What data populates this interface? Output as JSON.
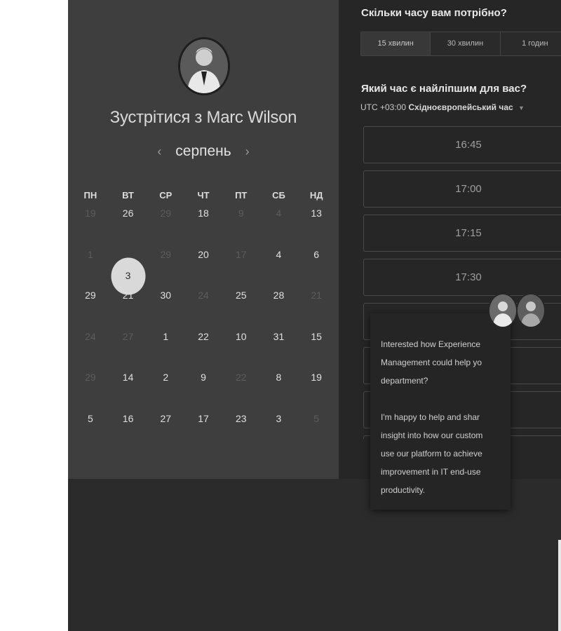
{
  "host": {
    "meet_title": "Зустрітися з Marc Wilson",
    "avatar_icon": "person-avatar-icon"
  },
  "calendar": {
    "month": "серпень",
    "prev_icon": "chevron-left-icon",
    "next_icon": "chevron-right-icon",
    "weekdays": [
      "ПН",
      "ВТ",
      "СР",
      "ЧТ",
      "ПТ",
      "СБ",
      "НД"
    ],
    "weeks": [
      [
        {
          "d": "19",
          "m": true
        },
        {
          "d": "26",
          "m": false
        },
        {
          "d": "29",
          "m": true
        },
        {
          "d": "18",
          "m": false
        },
        {
          "d": "9",
          "m": true
        },
        {
          "d": "4",
          "m": true
        },
        {
          "d": "13",
          "m": false
        }
      ],
      [
        {
          "d": "1",
          "m": true
        },
        {
          "d": "3",
          "m": false,
          "sel": true
        },
        {
          "d": "29",
          "m": true
        },
        {
          "d": "20",
          "m": false
        },
        {
          "d": "17",
          "m": true
        },
        {
          "d": "4",
          "m": false
        },
        {
          "d": "6",
          "m": false
        }
      ],
      [
        {
          "d": "29",
          "m": false
        },
        {
          "d": "21",
          "m": false
        },
        {
          "d": "30",
          "m": false
        },
        {
          "d": "24",
          "m": true
        },
        {
          "d": "25",
          "m": false
        },
        {
          "d": "28",
          "m": false
        },
        {
          "d": "21",
          "m": true
        }
      ],
      [
        {
          "d": "24",
          "m": true
        },
        {
          "d": "27",
          "m": true
        },
        {
          "d": "1",
          "m": false
        },
        {
          "d": "22",
          "m": false
        },
        {
          "d": "10",
          "m": false
        },
        {
          "d": "31",
          "m": false
        },
        {
          "d": "15",
          "m": false
        }
      ],
      [
        {
          "d": "29",
          "m": true
        },
        {
          "d": "14",
          "m": false
        },
        {
          "d": "2",
          "m": false
        },
        {
          "d": "9",
          "m": false
        },
        {
          "d": "22",
          "m": true
        },
        {
          "d": "8",
          "m": false
        },
        {
          "d": "19",
          "m": false
        }
      ],
      [
        {
          "d": "5",
          "m": false
        },
        {
          "d": "16",
          "m": false
        },
        {
          "d": "27",
          "m": false
        },
        {
          "d": "17",
          "m": false
        },
        {
          "d": "23",
          "m": false
        },
        {
          "d": "3",
          "m": false
        },
        {
          "d": "5",
          "m": true
        }
      ]
    ]
  },
  "duration": {
    "title": "Скільки часу вам потрібно?",
    "options": [
      "15 хвилин",
      "30 хвилин",
      "1 годин"
    ],
    "selected_index": 0
  },
  "time": {
    "title": "Який час є найліпшим для вас?",
    "tz_offset": "UTC +03:00",
    "tz_name": "Східноєвропейський час",
    "caret_icon": "caret-down-icon",
    "slots": [
      "16:45",
      "17:00",
      "17:15",
      "17:30",
      "",
      "",
      "",
      ""
    ]
  },
  "chat": {
    "message": "Interested how Experience\nManagement could help yo\ndepartment?\n\nI'm happy to help and shar\ninsight into how our custom\nuse our platform to achieve\nimprovement in IT end-use\nproductivity.",
    "avatar_icons": [
      "person-avatar-icon",
      "person-avatar-icon"
    ]
  }
}
